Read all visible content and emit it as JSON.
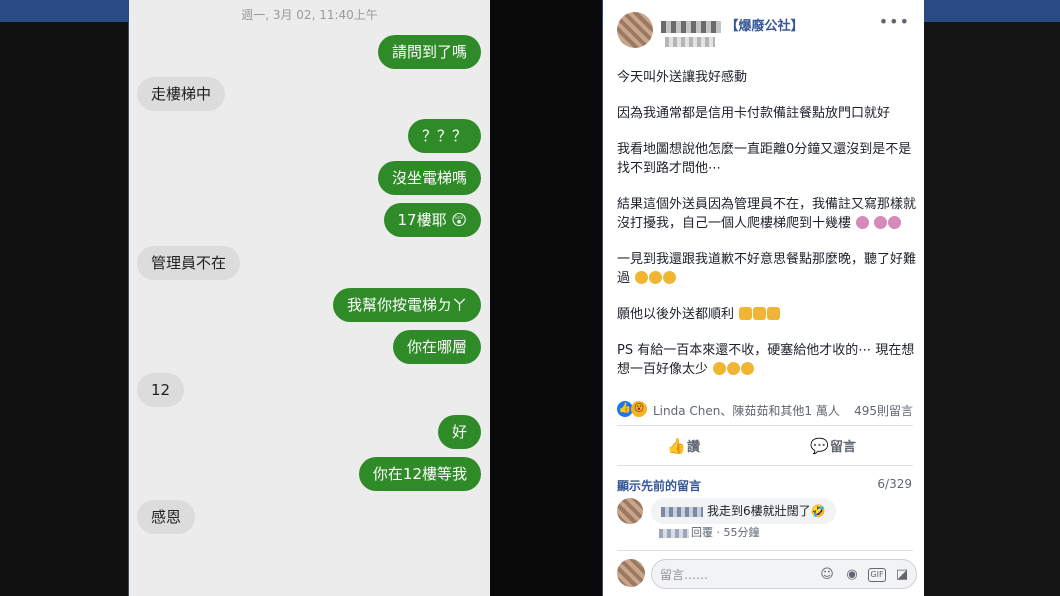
{
  "chat": {
    "date": "週一, 3月 02, 11:40上午",
    "messages": [
      {
        "side": "out",
        "text": "請問到了嗎"
      },
      {
        "side": "in",
        "text": "走樓梯中"
      },
      {
        "side": "out",
        "text": "？？？"
      },
      {
        "side": "out",
        "text": "沒坐電梯嗎"
      },
      {
        "side": "out",
        "text": "17樓耶 😲"
      },
      {
        "side": "in",
        "text": "管理員不在"
      },
      {
        "side": "out",
        "text": "我幫你按電梯ㄉㄚ"
      },
      {
        "side": "out",
        "text": "你在哪層"
      },
      {
        "side": "in",
        "text": "12"
      },
      {
        "side": "out",
        "text": "好"
      },
      {
        "side": "out",
        "text": "你在12樓等我"
      },
      {
        "side": "in",
        "text": "感恩"
      }
    ]
  },
  "post": {
    "group_name": "【爆廢公社】",
    "more_label": "•••",
    "paragraphs": [
      "今天叫外送讓我好感動",
      "因為我通常都是信用卡付款備註餐點放門口就好",
      "我看地圖想說他怎麼一直距離0分鐘又還沒到是不是找不到路才問他⋯",
      "結果這個外送員因為管理員不在，我備註又寫那樣就沒打擾我，自己一個人爬樓梯爬到十幾樓",
      "一見到我還跟我道歉不好意思餐點那麼晚，聽了好難過",
      "願他以後外送都順利",
      "PS 有給一百本來還不收，硬塞給他才收的⋯ 現在想想一百好像太少"
    ],
    "reacted_by": "Linda Chen、陳茹茹和其他1 萬人",
    "comment_count": "495則留言",
    "like_label": "讚",
    "comment_label": "留言",
    "previous_comments": "顯示先前的留言",
    "comment_counter": "6/329",
    "top_comment": "我走到6樓就壯闊了🤣",
    "comment_like_label": "回覆",
    "comment_time": "55分鐘",
    "write_placeholder": "留言……"
  },
  "colors": {
    "outgoing_bubble": "#2f8a28",
    "incoming_bubble": "#dcdcdc",
    "link": "#385898"
  }
}
